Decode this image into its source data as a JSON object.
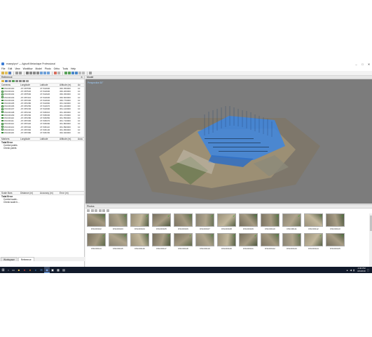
{
  "window": {
    "title": "examplpro* — Agisoft Metashape Professional",
    "minimize": "–",
    "maximize": "□",
    "close": "✕"
  },
  "menu": [
    "File",
    "Edit",
    "View",
    "Workflow",
    "Model",
    "Photo",
    "Ortho",
    "Tools",
    "Help"
  ],
  "reference_pane": {
    "title": "Reference",
    "close": "✕",
    "camera_columns": [
      "Cameras",
      "Longitude",
      "Latitude",
      "Altitude (m)",
      "Ac"
    ],
    "cameras": [
      {
        "name": "DSC00100",
        "lon": "-97.087550",
        "lat": "47.544900",
        "alt": "360.350000",
        "acc": "10"
      },
      {
        "name": "DSC00101",
        "lon": "-97.087520",
        "lat": "47.544900",
        "alt": "360.200000",
        "acc": "10"
      },
      {
        "name": "DSC00102",
        "lon": "-97.087500",
        "lat": "47.544920",
        "alt": "360.450000",
        "acc": "10"
      },
      {
        "name": "DSC00103",
        "lon": "-97.087410",
        "lat": "47.544930",
        "alt": "360.600000",
        "acc": "10"
      },
      {
        "name": "DSC00104",
        "lon": "-97.087300",
        "lat": "47.544940",
        "alt": "360.770000",
        "acc": "10"
      },
      {
        "name": "DSC00105",
        "lon": "-97.087280",
        "lat": "47.544960",
        "alt": "361.190000",
        "acc": "10"
      },
      {
        "name": "DSC00106",
        "lon": "-97.087250",
        "lat": "47.544970",
        "alt": "361.240000",
        "acc": "10"
      },
      {
        "name": "DSC00107",
        "lon": "-97.087230",
        "lat": "47.544990",
        "alt": "361.120000",
        "acc": "10"
      },
      {
        "name": "DSC00108",
        "lon": "-97.087240",
        "lat": "47.545010",
        "alt": "361.300000",
        "acc": "10"
      },
      {
        "name": "DSC00109",
        "lon": "-97.087260",
        "lat": "47.545030",
        "alt": "361.470000",
        "acc": "10"
      },
      {
        "name": "DSC00110",
        "lon": "-97.087280",
        "lat": "47.545050",
        "alt": "361.550000",
        "acc": "10"
      },
      {
        "name": "DSC00111",
        "lon": "-97.087300",
        "lat": "47.545070",
        "alt": "361.710000",
        "acc": "10"
      },
      {
        "name": "DSC00112",
        "lon": "-97.087320",
        "lat": "47.545090",
        "alt": "361.800000",
        "acc": "10"
      },
      {
        "name": "DSC00113",
        "lon": "-97.087340",
        "lat": "47.545110",
        "alt": "361.890000",
        "acc": "10"
      },
      {
        "name": "DSC00114",
        "lon": "-97.087360",
        "lat": "47.545130",
        "alt": "361.950000",
        "acc": "10"
      },
      {
        "name": "DSC00115",
        "lon": "-97.087380",
        "lat": "47.545150",
        "alt": "362.020000",
        "acc": "10"
      }
    ],
    "marker_columns": [
      "Markers",
      "Longitude",
      "Latitude",
      "Altitude (m)",
      "Accu"
    ],
    "marker_groups": {
      "total": "Total Error",
      "control": "Control points",
      "check": "Check points"
    },
    "scalebar_columns": [
      "Scale Bars",
      "Distance (m)",
      "Accuracy (m)",
      "Error (m)"
    ],
    "scalebar_groups": {
      "total": "Total Error",
      "control": "Control scale...",
      "check": "Check scale b..."
    }
  },
  "bottom_tabs": [
    "Workspace",
    "Reference"
  ],
  "model_pane": {
    "title": "Model",
    "projection": "Perspective 30°"
  },
  "photos_pane": {
    "title": "Photos",
    "thumbs": [
      "DSC00102",
      "DSC00103",
      "DSC00104",
      "DSC00105",
      "DSC00106",
      "DSC00107",
      "DSC00108",
      "DSC00109",
      "DSC00110",
      "DSC00111",
      "DSC00112",
      "DSC00113",
      "DSC00114",
      "DSC00115",
      "DSC00116",
      "DSC00117",
      "DSC00118",
      "DSC00119",
      "DSC00120",
      "DSC00121",
      "DSC00122",
      "DSC00123",
      "DSC00124",
      "DSC00125"
    ]
  },
  "taskbar": {
    "start_icon": "windows-icon",
    "apps": [
      "file-explorer",
      "chrome",
      "firefox",
      "edge",
      "mail",
      "metashape",
      "terminal",
      "calculator",
      "notes"
    ],
    "time": "4:06 PM",
    "date": "4/1/2019"
  },
  "colors": {
    "accent": "#3a7bd5",
    "viewport_bg": "#7c7c7c",
    "camera_plane": "#3d86e0",
    "check_green": "#3aa53a",
    "taskbar": "#111a2b"
  }
}
